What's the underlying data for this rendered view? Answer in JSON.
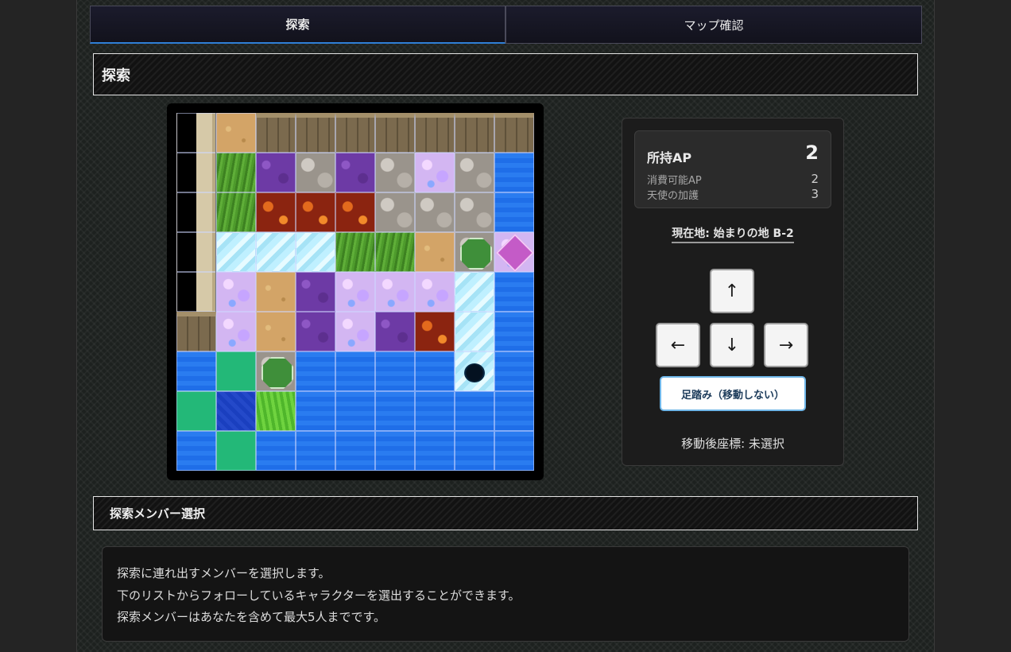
{
  "tabs": [
    {
      "label": "探索",
      "active": true
    },
    {
      "label": "マップ確認",
      "active": false
    }
  ],
  "section_explore": {
    "title": "探索"
  },
  "map": {
    "icon": "tile-map",
    "rows": [
      [
        "pillar",
        "sand",
        "wall",
        "wall",
        "wall",
        "wall",
        "wall",
        "wall",
        "wall"
      ],
      [
        "pillar",
        "grass",
        "purple",
        "stone",
        "purple",
        "stone",
        "crystal",
        "stone",
        "water"
      ],
      [
        "pillar",
        "grass",
        "lava",
        "lava",
        "lava",
        "stone",
        "stone",
        "stone",
        "water"
      ],
      [
        "pillar",
        "ice",
        "ice",
        "ice",
        "grass",
        "grass",
        "sand",
        "octa",
        "gem"
      ],
      [
        "pillar",
        "crystal",
        "sand",
        "purple",
        "crystal",
        "crystal",
        "crystal",
        "ice",
        "water"
      ],
      [
        "wall",
        "crystal",
        "sand",
        "purple",
        "crystal",
        "purple",
        "lava",
        "ice",
        "water"
      ],
      [
        "water",
        "teal",
        "octa",
        "water",
        "water",
        "water",
        "water",
        "hole",
        "water"
      ],
      [
        "teal",
        "deep",
        "lgrass",
        "water",
        "water",
        "water",
        "water",
        "water",
        "water"
      ],
      [
        "water",
        "teal",
        "water",
        "water",
        "water",
        "water",
        "water",
        "water",
        "water"
      ]
    ]
  },
  "ap_panel": {
    "ap_label": "所持AP",
    "ap_value": "2",
    "usable_label": "消費可能AP",
    "usable_value": "2",
    "blessing_label": "天使の加護",
    "blessing_value": "3",
    "location": "現在地: 始まりの地 B-2",
    "buttons": {
      "up": "↑",
      "left": "←",
      "down": "↓",
      "right": "→"
    },
    "stay_label": "足踏み（移動しない）",
    "after_coord": "移動後座標: 未選択"
  },
  "section_members": {
    "title": "探索メンバー選択"
  },
  "description": {
    "lines": [
      "探索に連れ出すメンバーを選択します。",
      "下のリストからフォローしているキャラクターを選出することができます。",
      "探索メンバーはあなたを含めて最大5人までです。"
    ]
  }
}
